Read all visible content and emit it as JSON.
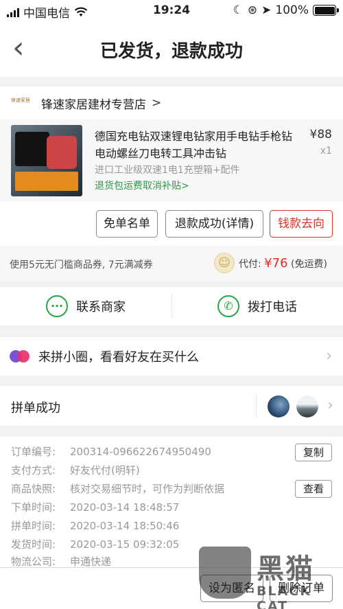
{
  "status_bar": {
    "carrier": "中国电信",
    "time": "19:24",
    "battery": "100%"
  },
  "nav": {
    "back_icon": "‹",
    "title": "已发货，退款成功"
  },
  "store": {
    "logo_text": "锋速家居",
    "name": "锋速家居建材专营店",
    "chevron": ">"
  },
  "product": {
    "name": "德国充电钻双速锂电钻家用手电钻手枪钻电动螺丝刀电转工具冲击钻",
    "price": "¥88",
    "quantity": "x1",
    "spec": "进口工业级双速1电1充塑箱+配件",
    "promo": "退货包运费取消补贴",
    "promo_chevron": ">"
  },
  "actions": {
    "free_list": "免单名单",
    "refund_detail": "退款成功(详情)",
    "money_where": "钱款去向"
  },
  "payment": {
    "coupon": "使用5元无门槛商品券, 7元满减券",
    "paid_label": "代付: ",
    "paid_amount": "¥76",
    "shipping": "(免运费)"
  },
  "contact": {
    "merchant": "联系商家",
    "phone": "拨打电话"
  },
  "circle": {
    "text": "来拼小圈，看看好友在买什么",
    "chevron": "›"
  },
  "group": {
    "text": "拼单成功",
    "chevron": "›"
  },
  "order_info": {
    "order_no_label": "订单编号:",
    "order_no": "200314-096622674950490",
    "copy_label": "复制",
    "pay_method_label": "支付方式:",
    "pay_method": "好友代付(明轩)",
    "snapshot_label": "商品快照:",
    "snapshot": "核对交易细节时，可作为判断依据",
    "view_label": "查看",
    "order_time_label": "下单时间:",
    "order_time": "2020-03-14 18:48:57",
    "group_time_label": "拼单时间:",
    "group_time": "2020-03-14 18:50:46",
    "ship_time_label": "发货时间:",
    "ship_time": "2020-03-15 09:32:05",
    "logistics_label": "物流公司:",
    "logistics": "申通快递"
  },
  "bottom_bar": {
    "anonymous": "设为匿名",
    "delete_order": "删除订单"
  },
  "watermark": {
    "cn": "黑猫",
    "en": "BLACK CAT"
  },
  "colors": {
    "accent_red": "#e02e24",
    "accent_green": "#27a543",
    "border_red": "#d9321f"
  }
}
